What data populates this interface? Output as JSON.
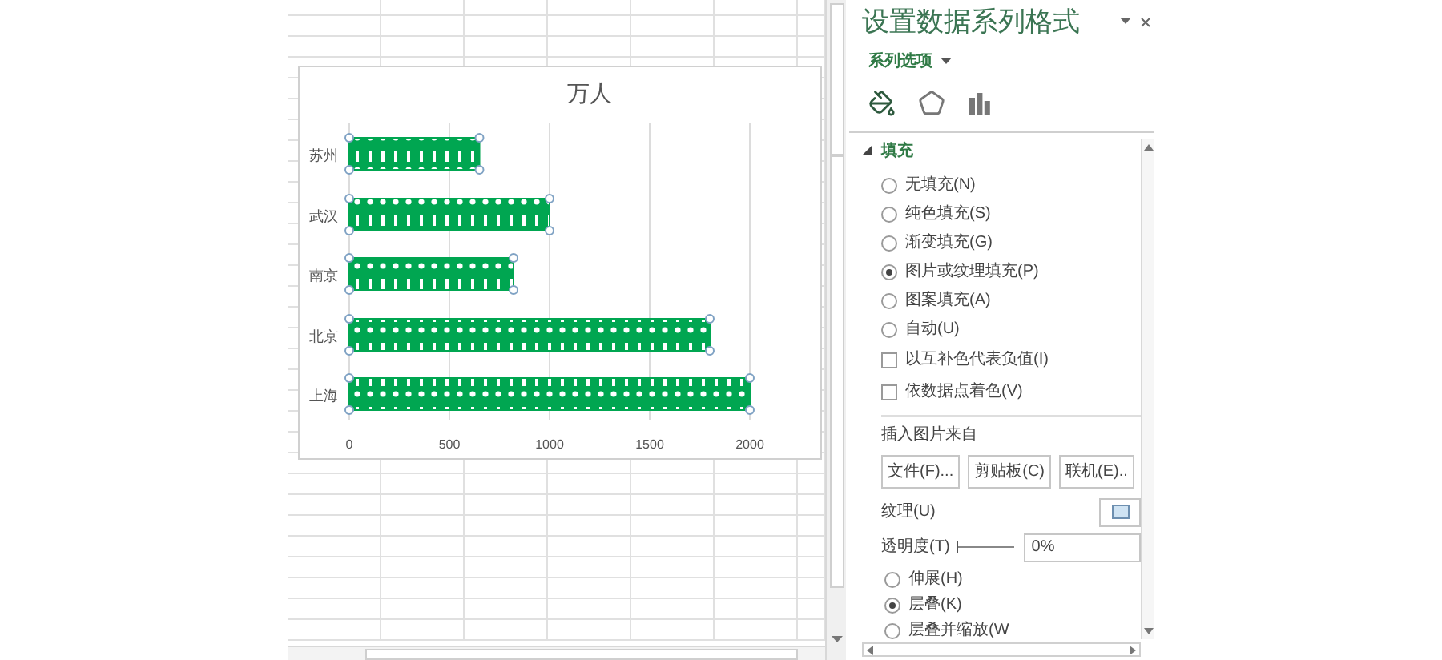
{
  "sheet": {
    "chart": {
      "chart_data": {
        "type": "bar",
        "orientation": "horizontal",
        "title": "万人",
        "categories": [
          "苏州",
          "武汉",
          "南京",
          "北京",
          "上海"
        ],
        "series": [
          {
            "color": "#00a651",
            "values": [
              650,
              1000,
              820,
              1800,
              2000
            ]
          }
        ],
        "grid": true,
        "xlim": [
          0,
          2000
        ],
        "xticks": [
          0,
          500,
          1000,
          1500,
          2000
        ]
      }
    }
  },
  "panel": {
    "title": "设置数据系列格式",
    "menu": "系列选项",
    "tabs": [
      {
        "kind": "fill",
        "selected": true
      },
      {
        "kind": "effects",
        "selected": false
      },
      {
        "kind": "series",
        "selected": false
      }
    ],
    "section": {
      "title": "填充",
      "expanded": true
    },
    "fill_types": [
      {
        "label": "无填充(N)",
        "selected": false
      },
      {
        "label": "纯色填充(S)",
        "selected": false
      },
      {
        "label": "渐变填充(G)",
        "selected": false
      },
      {
        "label": "图片或纹理填充(P)",
        "selected": true
      },
      {
        "label": "图案填充(A)",
        "selected": false
      },
      {
        "label": "自动(U)",
        "selected": false
      }
    ],
    "options": [
      {
        "label": "以互补色代表负值(I)",
        "checked": false
      },
      {
        "label": "依数据点着色(V)",
        "checked": false
      }
    ],
    "insert_from": {
      "label": "插入图片来自",
      "buttons": [
        "文件(F)...",
        "剪贴板(C)",
        "联机(E).."
      ]
    },
    "texture": {
      "label": "纹理(U)"
    },
    "transparency": {
      "label": "透明度(T)",
      "level": 0,
      "value": "0%"
    },
    "modes": [
      {
        "label": "伸展(H)",
        "selected": false
      },
      {
        "label": "层叠(K)",
        "selected": true
      },
      {
        "label": "层叠并缩放(W",
        "selected": false
      }
    ]
  }
}
